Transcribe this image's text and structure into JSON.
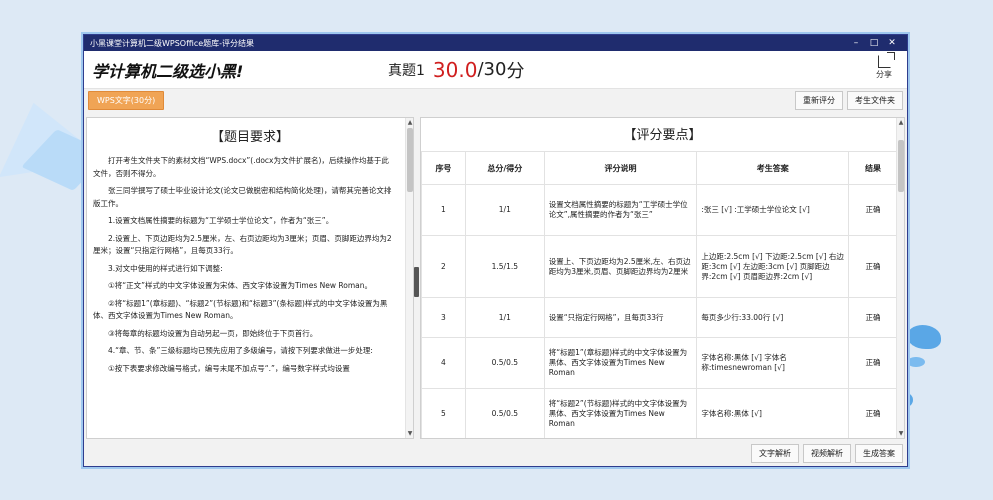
{
  "window": {
    "title": "小黑课堂计算机二级WPSOffice题库-评分结果",
    "controls": {
      "minimize": "–",
      "maximize": "□",
      "close": "✕"
    }
  },
  "header": {
    "logo": "学计算机二级选小黑!",
    "exam_name": "真题1",
    "score_got": "30.0",
    "score_sep": "/",
    "score_total": "30",
    "score_unit": "分",
    "share_label": "分享",
    "share_icon": "share-icon"
  },
  "toolbar": {
    "tab_label": "WPS文字(30分)",
    "regrade_label": "重新评分",
    "folder_label": "考生文件夹"
  },
  "left": {
    "title": "【题目要求】",
    "paragraphs": [
      "打开考生文件夹下的素材文档“WPS.docx”(.docx为文件扩展名)，后续操作均基于此文件，否则不得分。",
      "张三同学撰写了硕士毕业设计论文(论文已做脱密和结构简化处理)，请帮其完善论文排版工作。",
      "1.设置文档属性摘要的标题为“工学硕士学位论文”，作者为“张三”。",
      "2.设置上、下页边距均为2.5厘米，左、右页边距均为3厘米；页眉、页脚距边界均为2厘米；设置“只指定行网格”，且每页33行。",
      "3.对文中使用的样式进行如下调整:",
      "①将“正文”样式的中文字体设置为宋体、西文字体设置为Times New Roman。",
      "②将“标题1”(章标题)、“标题2”(节标题)和“标题3”(条标题)样式的中文字体设置为黑体、西文字体设置为Times New Roman。",
      "③将每章的标题均设置为自动另起一页，即始终位于下页首行。",
      "4.“章、节、条”三级标题均已预先应用了多级编号，请按下列要求做进一步处理:",
      "①按下表要求修改编号格式，编号末尾不加点号“.”，编号数字样式均设置"
    ]
  },
  "right": {
    "title": "【评分要点】",
    "headers": [
      "序号",
      "总分/得分",
      "评分说明",
      "考生答案",
      "结果"
    ],
    "rows": [
      {
        "no": "1",
        "score": "1/1",
        "desc": "设置文档属性摘要的标题为“工学硕士学位论文”,属性摘要的作者为“张三”",
        "answer": ":张三 [√] :工学硕士学位论文 [√]",
        "result": "正确"
      },
      {
        "no": "2",
        "score": "1.5/1.5",
        "desc": "设置上、下页边距均为2.5厘米,左、右页边距均为3厘米,页眉、页脚距边界均为2厘米",
        "answer": "上边距:2.5cm [√] 下边距:2.5cm [√] 右边距:3cm [√] 左边距:3cm [√] 页脚距边界:2cm [√] 页眉距边界:2cm [√]",
        "result": "正确"
      },
      {
        "no": "3",
        "score": "1/1",
        "desc": "设置“只指定行网格”，且每页33行",
        "answer": "每页多少行:33.00行 [√]",
        "result": "正确"
      },
      {
        "no": "4",
        "score": "0.5/0.5",
        "desc": "将“标题1”(章标题)样式的中文字体设置为黑体、西文字体设置为Times New Roman",
        "answer": "字体名称:黑体 [√] 字体名称:timesnewroman [√]",
        "result": "正确"
      },
      {
        "no": "5",
        "score": "0.5/0.5",
        "desc": "将“标题2”(节标题)样式的中文字体设置为黑体、西文字体设置为Times New Roman",
        "answer": "字体名称:黑体 [√]",
        "result": "正确"
      }
    ]
  },
  "footer": {
    "text_analysis": "文字解析",
    "video_analysis": "视频解析",
    "generate_answer": "生成答案"
  },
  "colors": {
    "titlebar": "#1f2c6e",
    "score_red": "#d01f1f",
    "tab_orange": "#f0a455"
  }
}
